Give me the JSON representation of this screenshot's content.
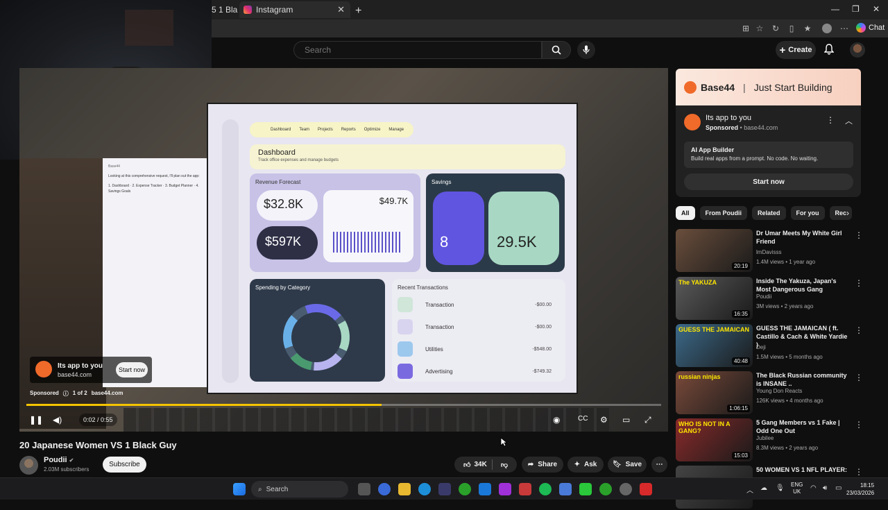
{
  "browser": {
    "tabs": [
      {
        "label": "5 1 Bla"
      },
      {
        "label": "Instagram"
      }
    ],
    "copilot_label": "Chat"
  },
  "yt_header": {
    "search_placeholder": "Search",
    "create_label": "Create"
  },
  "player": {
    "dashboard": {
      "nav_items": [
        "Dashboard",
        "Team",
        "Projects",
        "Reports",
        "Optimize",
        "Manage"
      ],
      "title": "Dashboard",
      "subtitle": "Track office expenses and manage budgets",
      "revenue_title": "Revenue Forecast",
      "revenue_this_month": "$32.8K",
      "revenue_projected": "$597K",
      "revenue_avg": "$49.7K",
      "savings_title": "Savings",
      "savings_active": "8",
      "savings_funds": "29.5K",
      "spending_title": "Spending by Category",
      "transactions_title": "Recent Transactions",
      "transactions": [
        {
          "name": "Transaction",
          "amount": "-$00.00"
        },
        {
          "name": "Transaction",
          "amount": "-$00.00"
        },
        {
          "name": "Utilities",
          "amount": "-$548.00"
        },
        {
          "name": "Advertising",
          "amount": "-$749.32"
        }
      ]
    },
    "ad": {
      "name": "Its app to you",
      "url": "base44.com",
      "start_label": "Start now",
      "sponsored": "Sponsored",
      "position": "1 of 2",
      "domain": "base44.com"
    },
    "time": "0:02 / 0:55",
    "progress": 0.56
  },
  "video": {
    "title": "20 Japanese Women VS 1 Black Guy",
    "channel": "Poudii",
    "subscribers": "2.03M subscribers",
    "subscribe_label": "Subscribe",
    "likes": "34K",
    "share_label": "Share",
    "ask_label": "Ask",
    "save_label": "Save"
  },
  "sidebar_ad": {
    "brand": "Base44",
    "tagline": "Just Start Building",
    "name": "Its app to you",
    "sponsored": "Sponsored",
    "domain": "base44.com",
    "card_title": "AI App Builder",
    "card_text": "Build real apps from a prompt. No code. No waiting.",
    "start_label": "Start now"
  },
  "chips": [
    "All",
    "From Poudii",
    "Related",
    "For you",
    "Rec"
  ],
  "recommendations": [
    {
      "title": "Dr Umar Meets My White Girl Friend",
      "channel": "lmDavisss",
      "meta": "1.4M views • 1 year ago",
      "duration": "20:19",
      "color": "#6a4e3c"
    },
    {
      "title": "Inside The Yakuza, Japan's Most Dangerous Gang",
      "channel": "Poudii",
      "meta": "3M views • 2 years ago",
      "duration": "16:35",
      "color": "#5a5a5a",
      "label": "The YAKUZA"
    },
    {
      "title": "GUESS THE JAMAICAN ( ft. Castillo & Cach & White Yardie )",
      "channel": "Deji",
      "meta": "1.5M views • 5 months ago",
      "duration": "40:48",
      "color": "#3c6a8a",
      "label": "GUESS THE JAMAICAN"
    },
    {
      "title": "The Black Russian community is INSANE ..",
      "channel": "Young Don Reacts",
      "meta": "126K views • 4 months ago",
      "duration": "1:06:15",
      "color": "#7a4a3a",
      "label": "russian ninjas"
    },
    {
      "title": "5 Gang Members vs 1 Fake | Odd One Out",
      "channel": "Jubilee",
      "meta": "8.3M views • 2 years ago",
      "duration": "15:03",
      "color": "#8a2a2a",
      "label": "WHO IS NOT IN A GANG?"
    },
    {
      "title": "50 WOMEN VS 1 NFL PLAYER:",
      "channel": "",
      "meta": "",
      "duration": "",
      "color": "#444"
    }
  ],
  "taskbar": {
    "search_label": "Search",
    "lang": "ENG",
    "region": "UK",
    "time": "18:15",
    "date": "23/03/2026"
  }
}
